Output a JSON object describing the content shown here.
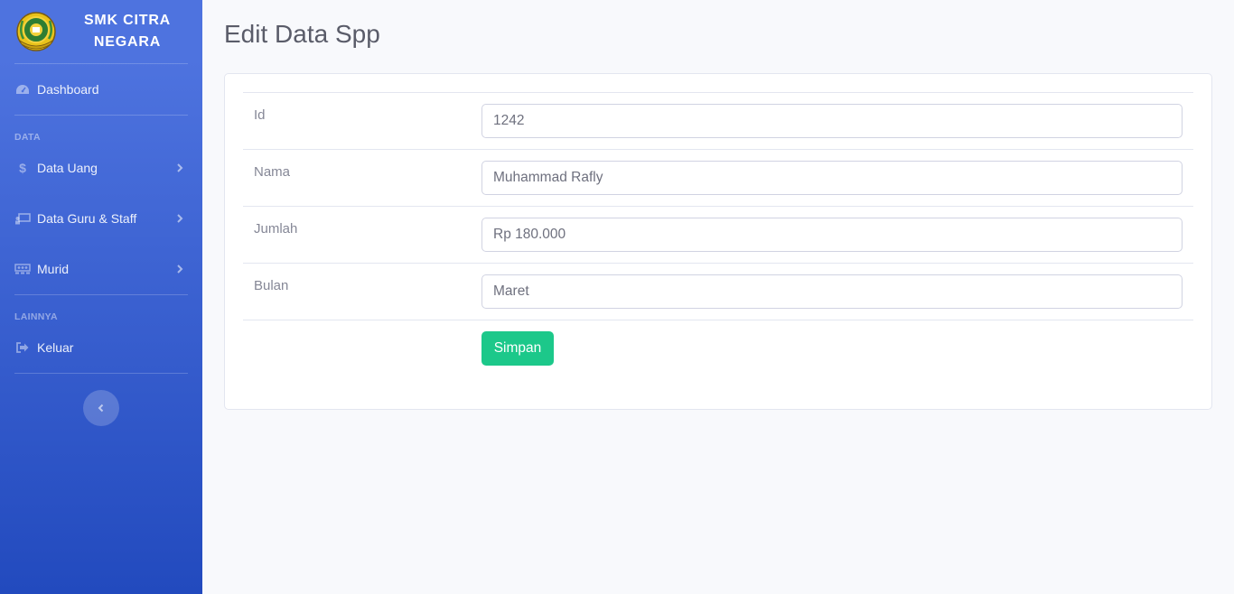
{
  "sidebar": {
    "brand": "SMK CITRA NEGARA",
    "dashboard": "Dashboard",
    "heading_data": "DATA",
    "data_uang": "Data Uang",
    "data_guru": "Data Guru & Staff",
    "murid": "Murid",
    "heading_lainnya": "LAINNYA",
    "keluar": "Keluar"
  },
  "page": {
    "title": "Edit Data Spp"
  },
  "form": {
    "id_label": "Id",
    "id_value": "1242",
    "nama_label": "Nama",
    "nama_value": "Muhammad Rafly",
    "jumlah_label": "Jumlah",
    "jumlah_value": "Rp 180.000",
    "bulan_label": "Bulan",
    "bulan_value": "Maret",
    "submit_label": "Simpan"
  },
  "colors": {
    "sidebar_top": "#4e73df",
    "sidebar_bottom": "#224abe",
    "success": "#1cc88a"
  },
  "icons": {
    "logo": "school-emblem",
    "dashboard": "tachometer-icon",
    "data_uang": "dollar-icon",
    "data_guru": "chalkboard-teacher-icon",
    "murid": "users-icon",
    "keluar": "sign-out-icon",
    "chevron": "chevron-right-icon",
    "toggle": "chevron-left-icon"
  }
}
